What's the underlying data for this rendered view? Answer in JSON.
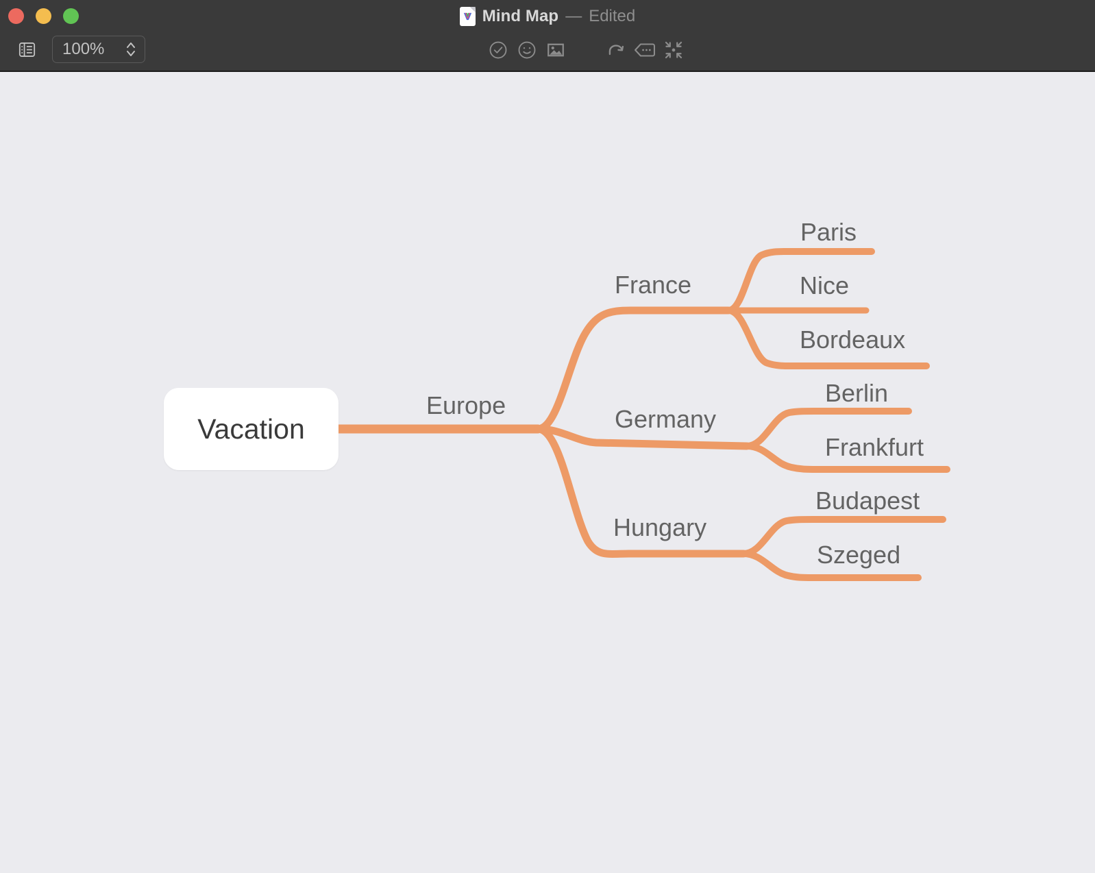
{
  "window": {
    "title": "Mind Map",
    "dash": "—",
    "subtitle": "Edited",
    "doc_icon": "document-icon",
    "traffic_lights": [
      {
        "name": "close",
        "color": "#ec6a5f"
      },
      {
        "name": "minimize",
        "color": "#f4bd4f"
      },
      {
        "name": "maximize",
        "color": "#61c454"
      }
    ]
  },
  "toolbar": {
    "sidebar_toggle_icon": "sidebar-list-icon",
    "zoom_value": "100%",
    "zoom_stepper_icon": "stepper-up-down-icon",
    "actions": [
      {
        "icon": "checkmark-circle-icon",
        "name": "task-button"
      },
      {
        "icon": "smiley-face-icon",
        "name": "sticker-button"
      },
      {
        "icon": "image-icon",
        "name": "image-button"
      },
      {
        "icon": "redo-arrow-icon",
        "name": "redo-button"
      },
      {
        "icon": "comment-bubble-icon",
        "name": "note-button"
      },
      {
        "icon": "focus-collapse-icon",
        "name": "focus-button"
      }
    ]
  },
  "colors": {
    "canvas_background": "#ebebef",
    "branch": "#ed9a66",
    "root_fill": "#ffffff",
    "root_text": "#3a3a3a",
    "node_text": "#636363",
    "titlebar": "#3a3a3a"
  },
  "mindmap": {
    "root": {
      "label": "Vacation"
    },
    "nodes": [
      {
        "id": "europe",
        "label": "Europe",
        "level": 1
      },
      {
        "id": "france",
        "label": "France",
        "level": 2,
        "parent": "europe"
      },
      {
        "id": "paris",
        "label": "Paris",
        "level": 3,
        "parent": "france"
      },
      {
        "id": "nice",
        "label": "Nice",
        "level": 3,
        "parent": "france"
      },
      {
        "id": "bordeaux",
        "label": "Bordeaux",
        "level": 3,
        "parent": "france"
      },
      {
        "id": "germany",
        "label": "Germany",
        "level": 2,
        "parent": "europe"
      },
      {
        "id": "berlin",
        "label": "Berlin",
        "level": 3,
        "parent": "germany"
      },
      {
        "id": "frankfurt",
        "label": "Frankfurt",
        "level": 3,
        "parent": "germany"
      },
      {
        "id": "hungary",
        "label": "Hungary",
        "level": 2,
        "parent": "europe"
      },
      {
        "id": "budapest",
        "label": "Budapest",
        "level": 3,
        "parent": "hungary"
      },
      {
        "id": "szeged",
        "label": "Szeged",
        "level": 3,
        "parent": "hungary"
      }
    ]
  }
}
